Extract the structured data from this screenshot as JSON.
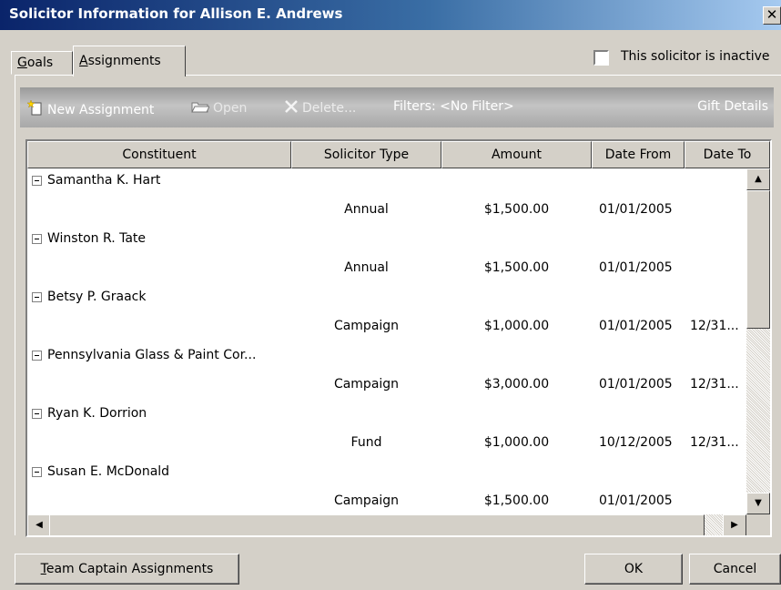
{
  "window": {
    "title": "Solicitor Information for Allison E. Andrews",
    "close_glyph": "✕"
  },
  "tabs": [
    {
      "label_first": "G",
      "label_rest": "oals",
      "active": false
    },
    {
      "label_first": "A",
      "label_rest": "ssignments",
      "active": true
    }
  ],
  "inactive_checkbox": {
    "label": "This solicitor is inactive",
    "checked": false
  },
  "toolbar": {
    "new_label": "New Assignment",
    "open_label": "Open",
    "delete_label": "Delete...",
    "filters_label": "Filters: <No Filter>",
    "gift_details_label": "Gift Details"
  },
  "grid": {
    "columns": [
      "Constituent",
      "Solicitor Type",
      "Amount",
      "Date From",
      "Date To"
    ],
    "groups": [
      {
        "constituent": "Samantha K. Hart",
        "type": "Annual",
        "amount": "$1,500.00",
        "date_from": "01/01/2005",
        "date_to": ""
      },
      {
        "constituent": "Winston R. Tate",
        "type": "Annual",
        "amount": "$1,500.00",
        "date_from": "01/01/2005",
        "date_to": ""
      },
      {
        "constituent": "Betsy P. Graack",
        "type": "Campaign",
        "amount": "$1,000.00",
        "date_from": "01/01/2005",
        "date_to": "12/31..."
      },
      {
        "constituent": "Pennsylvania Glass & Paint Cor...",
        "type": "Campaign",
        "amount": "$3,000.00",
        "date_from": "01/01/2005",
        "date_to": "12/31..."
      },
      {
        "constituent": "Ryan K. Dorrion",
        "type": "Fund",
        "amount": "$1,000.00",
        "date_from": "10/12/2005",
        "date_to": "12/31..."
      },
      {
        "constituent": "Susan E. McDonald",
        "type": "Campaign",
        "amount": "$1,500.00",
        "date_from": "01/01/2005",
        "date_to": ""
      }
    ]
  },
  "scrollbars": {
    "up": "▲",
    "down": "▼",
    "left": "◀",
    "right": "▶"
  },
  "buttons": {
    "team_first": "T",
    "team_rest": "eam Captain Assignments",
    "ok": "OK",
    "cancel": "Cancel"
  }
}
